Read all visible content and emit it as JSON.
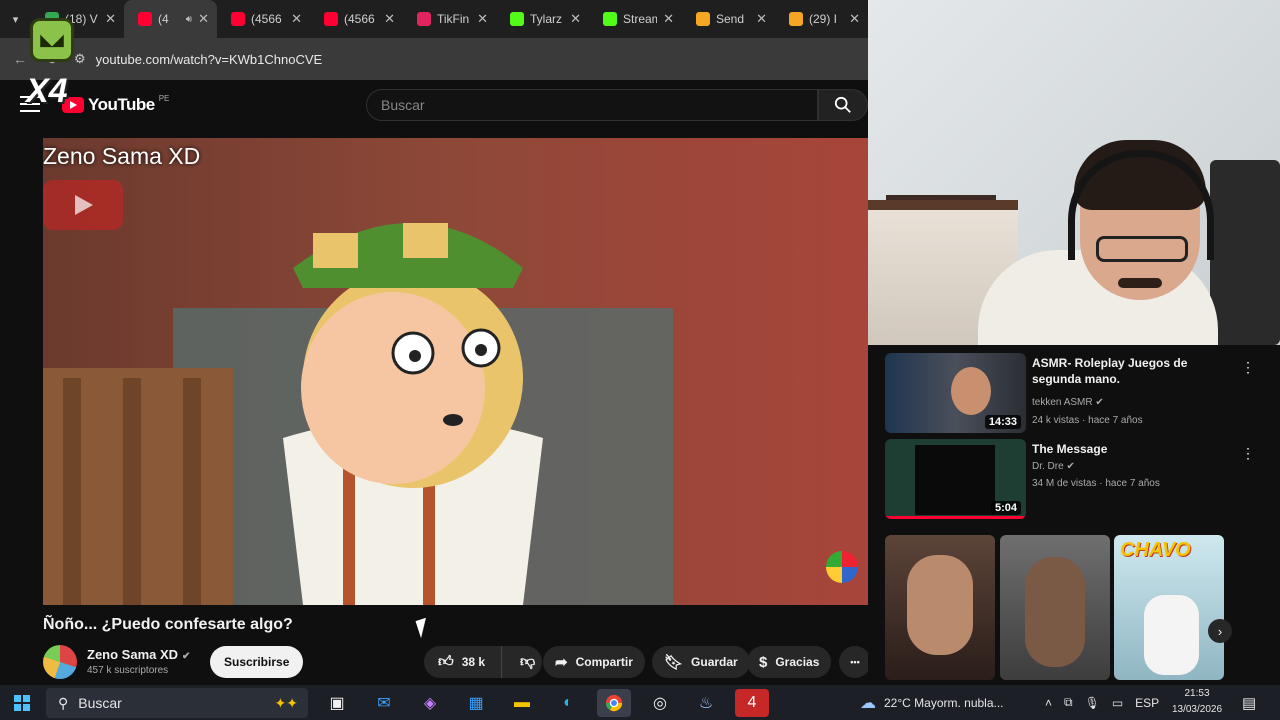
{
  "browser": {
    "tabs": [
      {
        "label": "(18) V",
        "color": "#34a853",
        "active": false
      },
      {
        "label": "(4",
        "color": "#ff0033",
        "active": true
      },
      {
        "label": "(4566",
        "color": "#ff0033",
        "active": false
      },
      {
        "label": "(4566",
        "color": "#ff0033",
        "active": false
      },
      {
        "label": "TikFin",
        "color": "#e0245e",
        "active": false
      },
      {
        "label": "Tylarz",
        "color": "#53fc18",
        "active": false
      },
      {
        "label": "Stream",
        "color": "#53fc18",
        "active": false
      },
      {
        "label": "Send",
        "color": "#f5a623",
        "active": false
      },
      {
        "label": "(29) I",
        "color": "#f5a623",
        "active": false
      }
    ],
    "close_glyph": "✕",
    "url": "youtube.com/watch?v=KWb1ChnoCVE"
  },
  "overlay": {
    "logo_text": "X4"
  },
  "youtube": {
    "logo_text": "YouTube",
    "region": "PE",
    "search_placeholder": "Buscar",
    "video_overlay_title": "Zeno Sama XD",
    "video_title": "Ñoño... ¿Puedo confesarte algo?",
    "channel_name": "Zeno Sama XD",
    "subscribers": "457 k suscriptores",
    "subscribe_label": "Suscribirse",
    "like_count": "38 k",
    "share_label": "Compartir",
    "save_label": "Guardar",
    "thanks_label": "Gracias",
    "more_glyph": "•••"
  },
  "suggestions": [
    {
      "title": "ASMR- Roleplay Juegos de segunda mano.",
      "channel": "tekken ASMR",
      "meta": "24 k vistas · hace 7 años",
      "duration": "14:33"
    },
    {
      "title": "The Message",
      "channel": "Dr. Dre",
      "meta": "34 M de vistas · hace 7 años",
      "duration": "5:04"
    }
  ],
  "shorts": {
    "chavo_logo": "CHAVO",
    "next_glyph": "›"
  },
  "taskbar": {
    "search_placeholder": "Buscar",
    "weather": "22°C  Mayorm. nubla...",
    "language": "ESP",
    "time": "21:53",
    "date": "13/03/2026"
  },
  "colors": {
    "accent": "#ff0033",
    "background": "#0f0f0f",
    "taskbar": "#1c1f26"
  }
}
